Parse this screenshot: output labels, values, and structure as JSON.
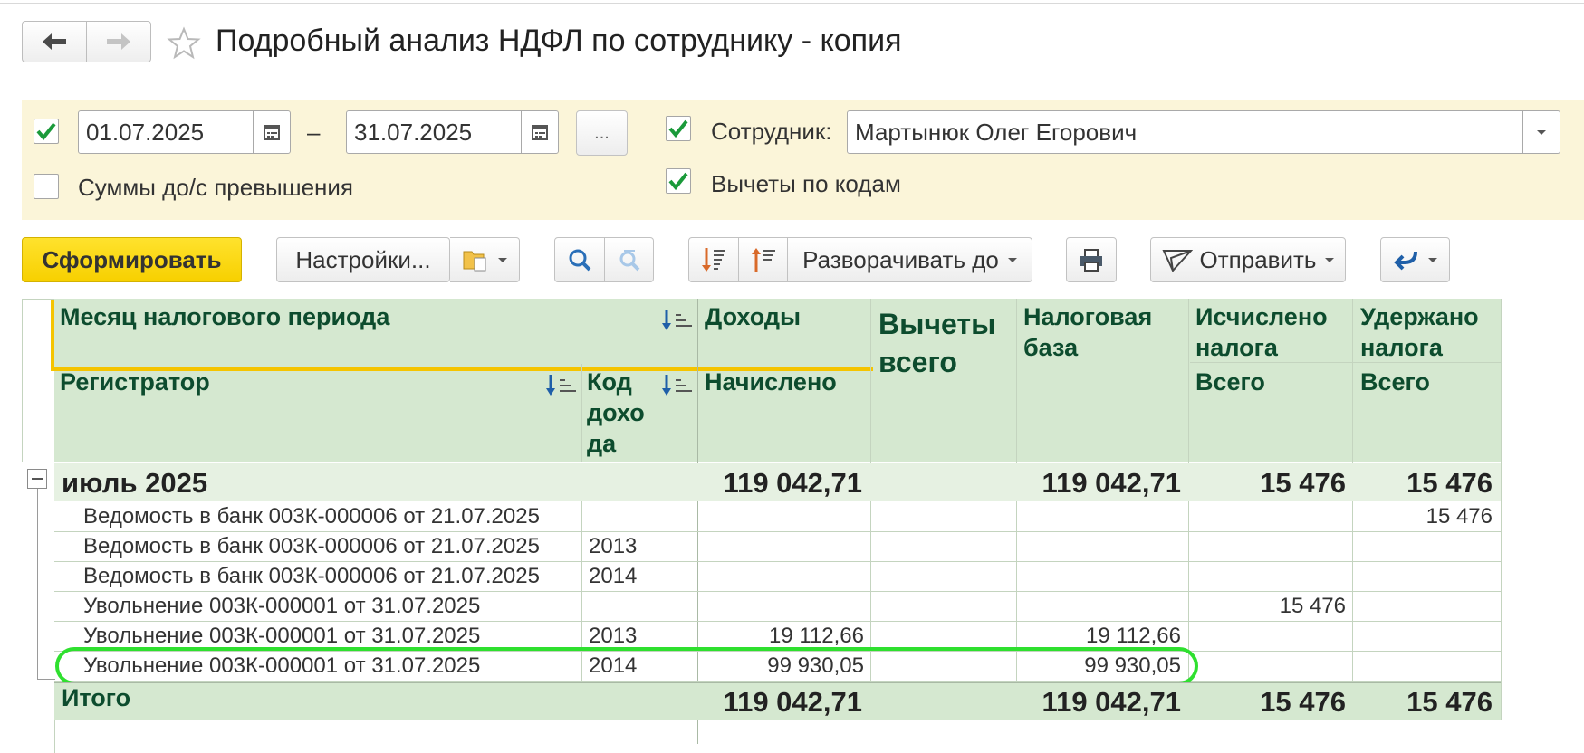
{
  "window": {
    "title": "Подробный анализ НДФЛ по сотруднику - копия",
    "back_icon": "arrow-left-icon",
    "forward_icon": "arrow-right-icon",
    "favorite_icon": "star-icon"
  },
  "filters": {
    "period_enabled": true,
    "date_from": "01.07.2025",
    "dash": "–",
    "date_to": "31.07.2025",
    "period_button": "...",
    "employee_enabled": true,
    "employee_label": "Сотрудник:",
    "employee_value": "Мартынюк Олег Егорович",
    "exceed_enabled": false,
    "exceed_label": "Суммы до/с превышения",
    "deductions_enabled": true,
    "deductions_label": "Вычеты по кодам"
  },
  "toolbar": {
    "generate": "Сформировать",
    "settings": "Настройки...",
    "expand_to": "Разворачивать до",
    "send": "Отправить"
  },
  "report": {
    "headers": {
      "month": "Месяц налогового периода",
      "registrar": "Регистратор",
      "code": "Код дохо да",
      "income": "Доходы",
      "accrued": "Начислено",
      "deductions": "Вычеты всего",
      "tax_base": "Налоговая база",
      "tax_calc": "Исчислено налога",
      "tax_calc_sub": "Всего",
      "tax_withheld": "Удержано налога",
      "tax_withheld_sub": "Всего"
    },
    "group": {
      "label": "июль 2025",
      "accrued": "119 042,71",
      "tax_base": "119 042,71",
      "tax_calc": "15 476",
      "tax_withheld": "15 476"
    },
    "rows": [
      {
        "registrar": "Ведомость в банк 003К-000006 от 21.07.2025",
        "code": "",
        "accrued": "",
        "tax_base": "",
        "tax_calc": "",
        "tax_withheld": "15 476"
      },
      {
        "registrar": "Ведомость в банк 003К-000006 от 21.07.2025",
        "code": "2013",
        "accrued": "",
        "tax_base": "",
        "tax_calc": "",
        "tax_withheld": ""
      },
      {
        "registrar": "Ведомость в банк 003К-000006 от 21.07.2025",
        "code": "2014",
        "accrued": "",
        "tax_base": "",
        "tax_calc": "",
        "tax_withheld": ""
      },
      {
        "registrar": "Увольнение 003К-000001 от 31.07.2025",
        "code": "",
        "accrued": "",
        "tax_base": "",
        "tax_calc": "15 476",
        "tax_withheld": ""
      },
      {
        "registrar": "Увольнение 003К-000001 от 31.07.2025",
        "code": "2013",
        "accrued": "19 112,66",
        "tax_base": "19 112,66",
        "tax_calc": "",
        "tax_withheld": ""
      },
      {
        "registrar": "Увольнение 003К-000001 от 31.07.2025",
        "code": "2014",
        "accrued": "99 930,05",
        "tax_base": "99 930,05",
        "tax_calc": "",
        "tax_withheld": ""
      }
    ],
    "total": {
      "label": "Итого",
      "accrued": "119 042,71",
      "tax_base": "119 042,71",
      "tax_calc": "15 476",
      "tax_withheld": "15 476"
    }
  },
  "colors": {
    "highlight": "#2fe02f",
    "accent": "#f7d000",
    "header_bg": "#d5e8d0",
    "panel_bg": "#fbf5d9"
  }
}
